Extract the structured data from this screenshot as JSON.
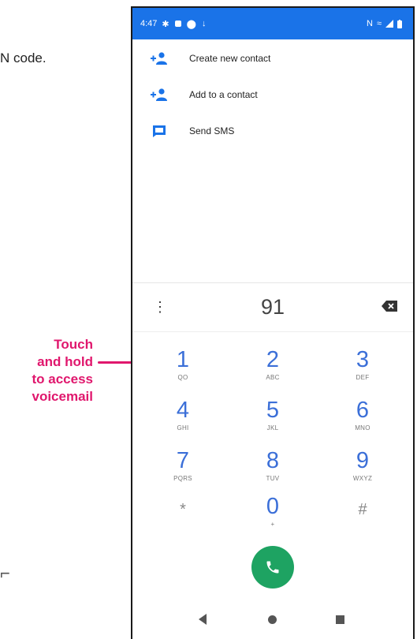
{
  "context": {
    "top_fragment": "N code.",
    "callout": [
      "Touch",
      "and hold",
      "to access",
      "voicemail"
    ]
  },
  "status_bar": {
    "time": "4:47",
    "carrier": "N"
  },
  "menu": [
    {
      "label": "Create new contact",
      "icon": "add-person-icon"
    },
    {
      "label": "Add to a contact",
      "icon": "add-person-icon"
    },
    {
      "label": "Send SMS",
      "icon": "message-icon"
    }
  ],
  "dialer": {
    "number": "91",
    "keys": [
      {
        "digit": "1",
        "letters": "QO"
      },
      {
        "digit": "2",
        "letters": "ABC"
      },
      {
        "digit": "3",
        "letters": "DEF"
      },
      {
        "digit": "4",
        "letters": "GHI"
      },
      {
        "digit": "5",
        "letters": "JKL"
      },
      {
        "digit": "6",
        "letters": "MNO"
      },
      {
        "digit": "7",
        "letters": "PQRS"
      },
      {
        "digit": "8",
        "letters": "TUV"
      },
      {
        "digit": "9",
        "letters": "WXYZ"
      },
      {
        "digit": "*",
        "letters": ""
      },
      {
        "digit": "0",
        "letters": "+"
      },
      {
        "digit": "#",
        "letters": ""
      }
    ]
  },
  "colors": {
    "status_bar": "#1a73e8",
    "digits": "#3b6fd8",
    "call_button": "#1ea362",
    "callout": "#e0176d"
  }
}
